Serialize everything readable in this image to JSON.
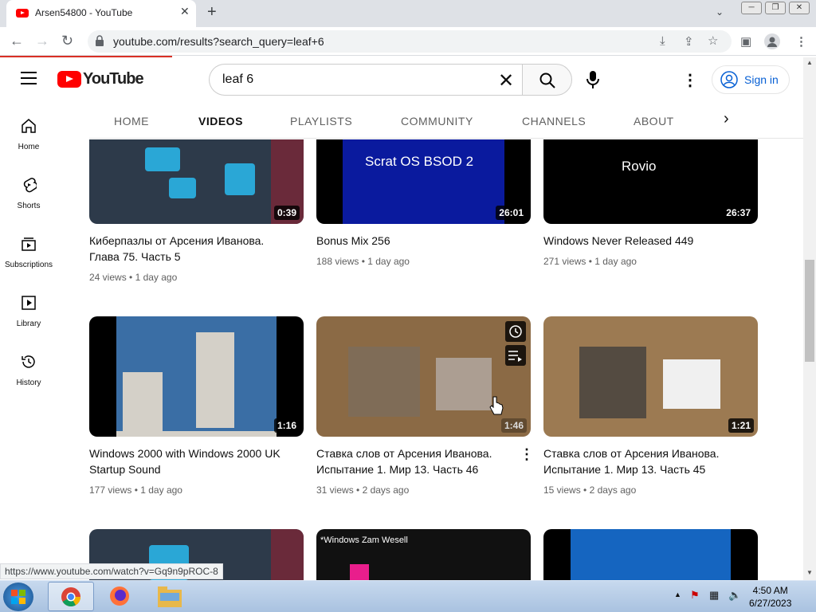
{
  "browser": {
    "tab_title": "Arsen54800 - YouTube",
    "url": "youtube.com/results?search_query=leaf+6",
    "status_url": "https://www.youtube.com/watch?v=Gq9n9pROC-8"
  },
  "youtube": {
    "logo_text": "YouTube",
    "search_value": "leaf 6",
    "signin_label": "Sign in",
    "tabs": [
      "HOME",
      "VIDEOS",
      "PLAYLISTS",
      "COMMUNITY",
      "CHANNELS",
      "ABOUT"
    ],
    "active_tab": "VIDEOS"
  },
  "sidebar": {
    "items": [
      {
        "label": "Home",
        "icon": "home-icon"
      },
      {
        "label": "Shorts",
        "icon": "shorts-icon"
      },
      {
        "label": "Subscriptions",
        "icon": "subscriptions-icon"
      },
      {
        "label": "Library",
        "icon": "library-icon"
      },
      {
        "label": "History",
        "icon": "history-icon"
      }
    ]
  },
  "videos": [
    {
      "title": "Киберпазлы от Арсения Иванова. Глава 75. Часть 5",
      "views": "24 views",
      "age": "1 day ago",
      "duration": "0:39",
      "thumb_color": "#2d3a4a",
      "thumb_text": ""
    },
    {
      "title": "Bonus Mix 256",
      "views": "188 views",
      "age": "1 day ago",
      "duration": "26:01",
      "thumb_color": "#0a1a9e",
      "thumb_text": "Scrat OS BSOD 2"
    },
    {
      "title": "Windows Never Released 449",
      "views": "271 views",
      "age": "1 day ago",
      "duration": "26:37",
      "thumb_color": "#000000",
      "thumb_text": "Rovio"
    },
    {
      "title": "Windows 2000 with Windows 2000 UK Startup Sound",
      "views": "177 views",
      "age": "1 day ago",
      "duration": "1:16",
      "thumb_color": "#3a6ea5",
      "thumb_text": ""
    },
    {
      "title": "Ставка слов от Арсения Иванова. Испытание 1. Мир 13. Часть 46",
      "views": "31 views",
      "age": "2 days ago",
      "duration": "1:46",
      "thumb_color": "#8b6a45",
      "thumb_text": ""
    },
    {
      "title": "Ставка слов от Арсения Иванова. Испытание 1. Мир 13. Часть 45",
      "views": "15 views",
      "age": "2 days ago",
      "duration": "1:21",
      "thumb_color": "#9c7a52",
      "thumb_text": ""
    },
    {
      "title": "",
      "views": "",
      "age": "",
      "duration": "",
      "thumb_color": "#2d3a4a",
      "thumb_text": ""
    },
    {
      "title": "",
      "views": "",
      "age": "",
      "duration": "",
      "thumb_color": "#111111",
      "thumb_text": "*Windows Zam Wesell"
    },
    {
      "title": "",
      "views": "",
      "age": "",
      "duration": "",
      "thumb_color": "#1565c0",
      "thumb_text": ""
    }
  ],
  "taskbar": {
    "time": "4:50 AM",
    "date": "6/27/2023"
  }
}
